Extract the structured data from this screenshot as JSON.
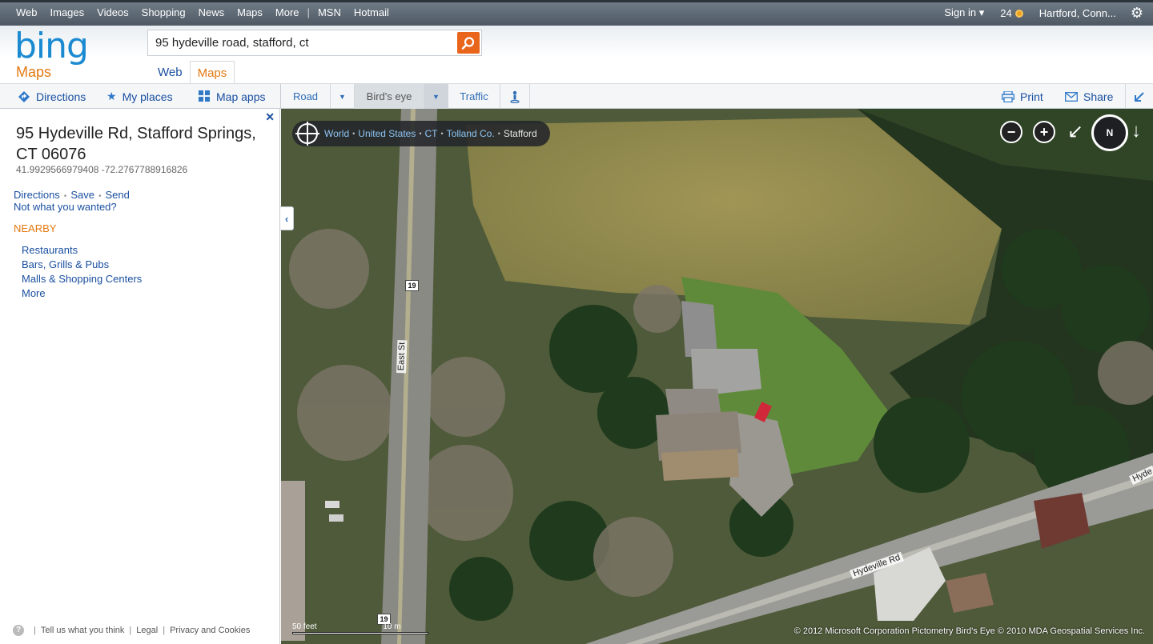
{
  "topnav": {
    "links": [
      "Web",
      "Images",
      "Videos",
      "Shopping",
      "News",
      "Maps",
      "More"
    ],
    "extra": [
      "MSN",
      "Hotmail"
    ],
    "sign_in": "Sign in ▾",
    "rewards_count": "24",
    "location": "Hartford, Conn..."
  },
  "header": {
    "logo": "bing",
    "logo_sub": "Maps",
    "search_value": "95 hydeville road, stafford, ct",
    "scopes": [
      "Web",
      "Maps"
    ],
    "active_scope": "Maps"
  },
  "toolbar": {
    "directions": "Directions",
    "my_places": "My places",
    "map_apps": "Map apps",
    "road": "Road",
    "birds_eye": "Bird's eye",
    "traffic": "Traffic",
    "print": "Print",
    "share": "Share"
  },
  "result": {
    "address": "95 Hydeville Rd, Stafford Springs, CT 06076",
    "coords": "41.9929566979408 -72.2767788916826",
    "actions": [
      "Directions",
      "Save",
      "Send"
    ],
    "not_wanted": "Not what you wanted?",
    "nearby_heading": "NEARBY",
    "nearby": [
      "Restaurants",
      "Bars, Grills & Pubs",
      "Malls & Shopping Centers",
      "More"
    ]
  },
  "footer": {
    "help": "?",
    "links": [
      "Tell us what you think",
      "Legal",
      "Privacy and Cookies"
    ]
  },
  "map": {
    "breadcrumb": [
      "World",
      "United States",
      "CT",
      "Tolland Co.",
      "Stafford"
    ],
    "compass": "N",
    "labels": {
      "east_st": "East St",
      "hydeville_rd": "Hydeville Rd",
      "hydeville_edge": "Hyde",
      "route": "19"
    },
    "scale_label": "50 feet",
    "scale_label2": "10 m",
    "copyright": "© 2012 Microsoft Corporation   Pictometry Bird's Eye © 2010 MDA Geospatial Services Inc."
  },
  "colors": {
    "accent_orange": "#e47911",
    "link_blue": "#1a4fa0",
    "search_button": "#e8651b"
  }
}
